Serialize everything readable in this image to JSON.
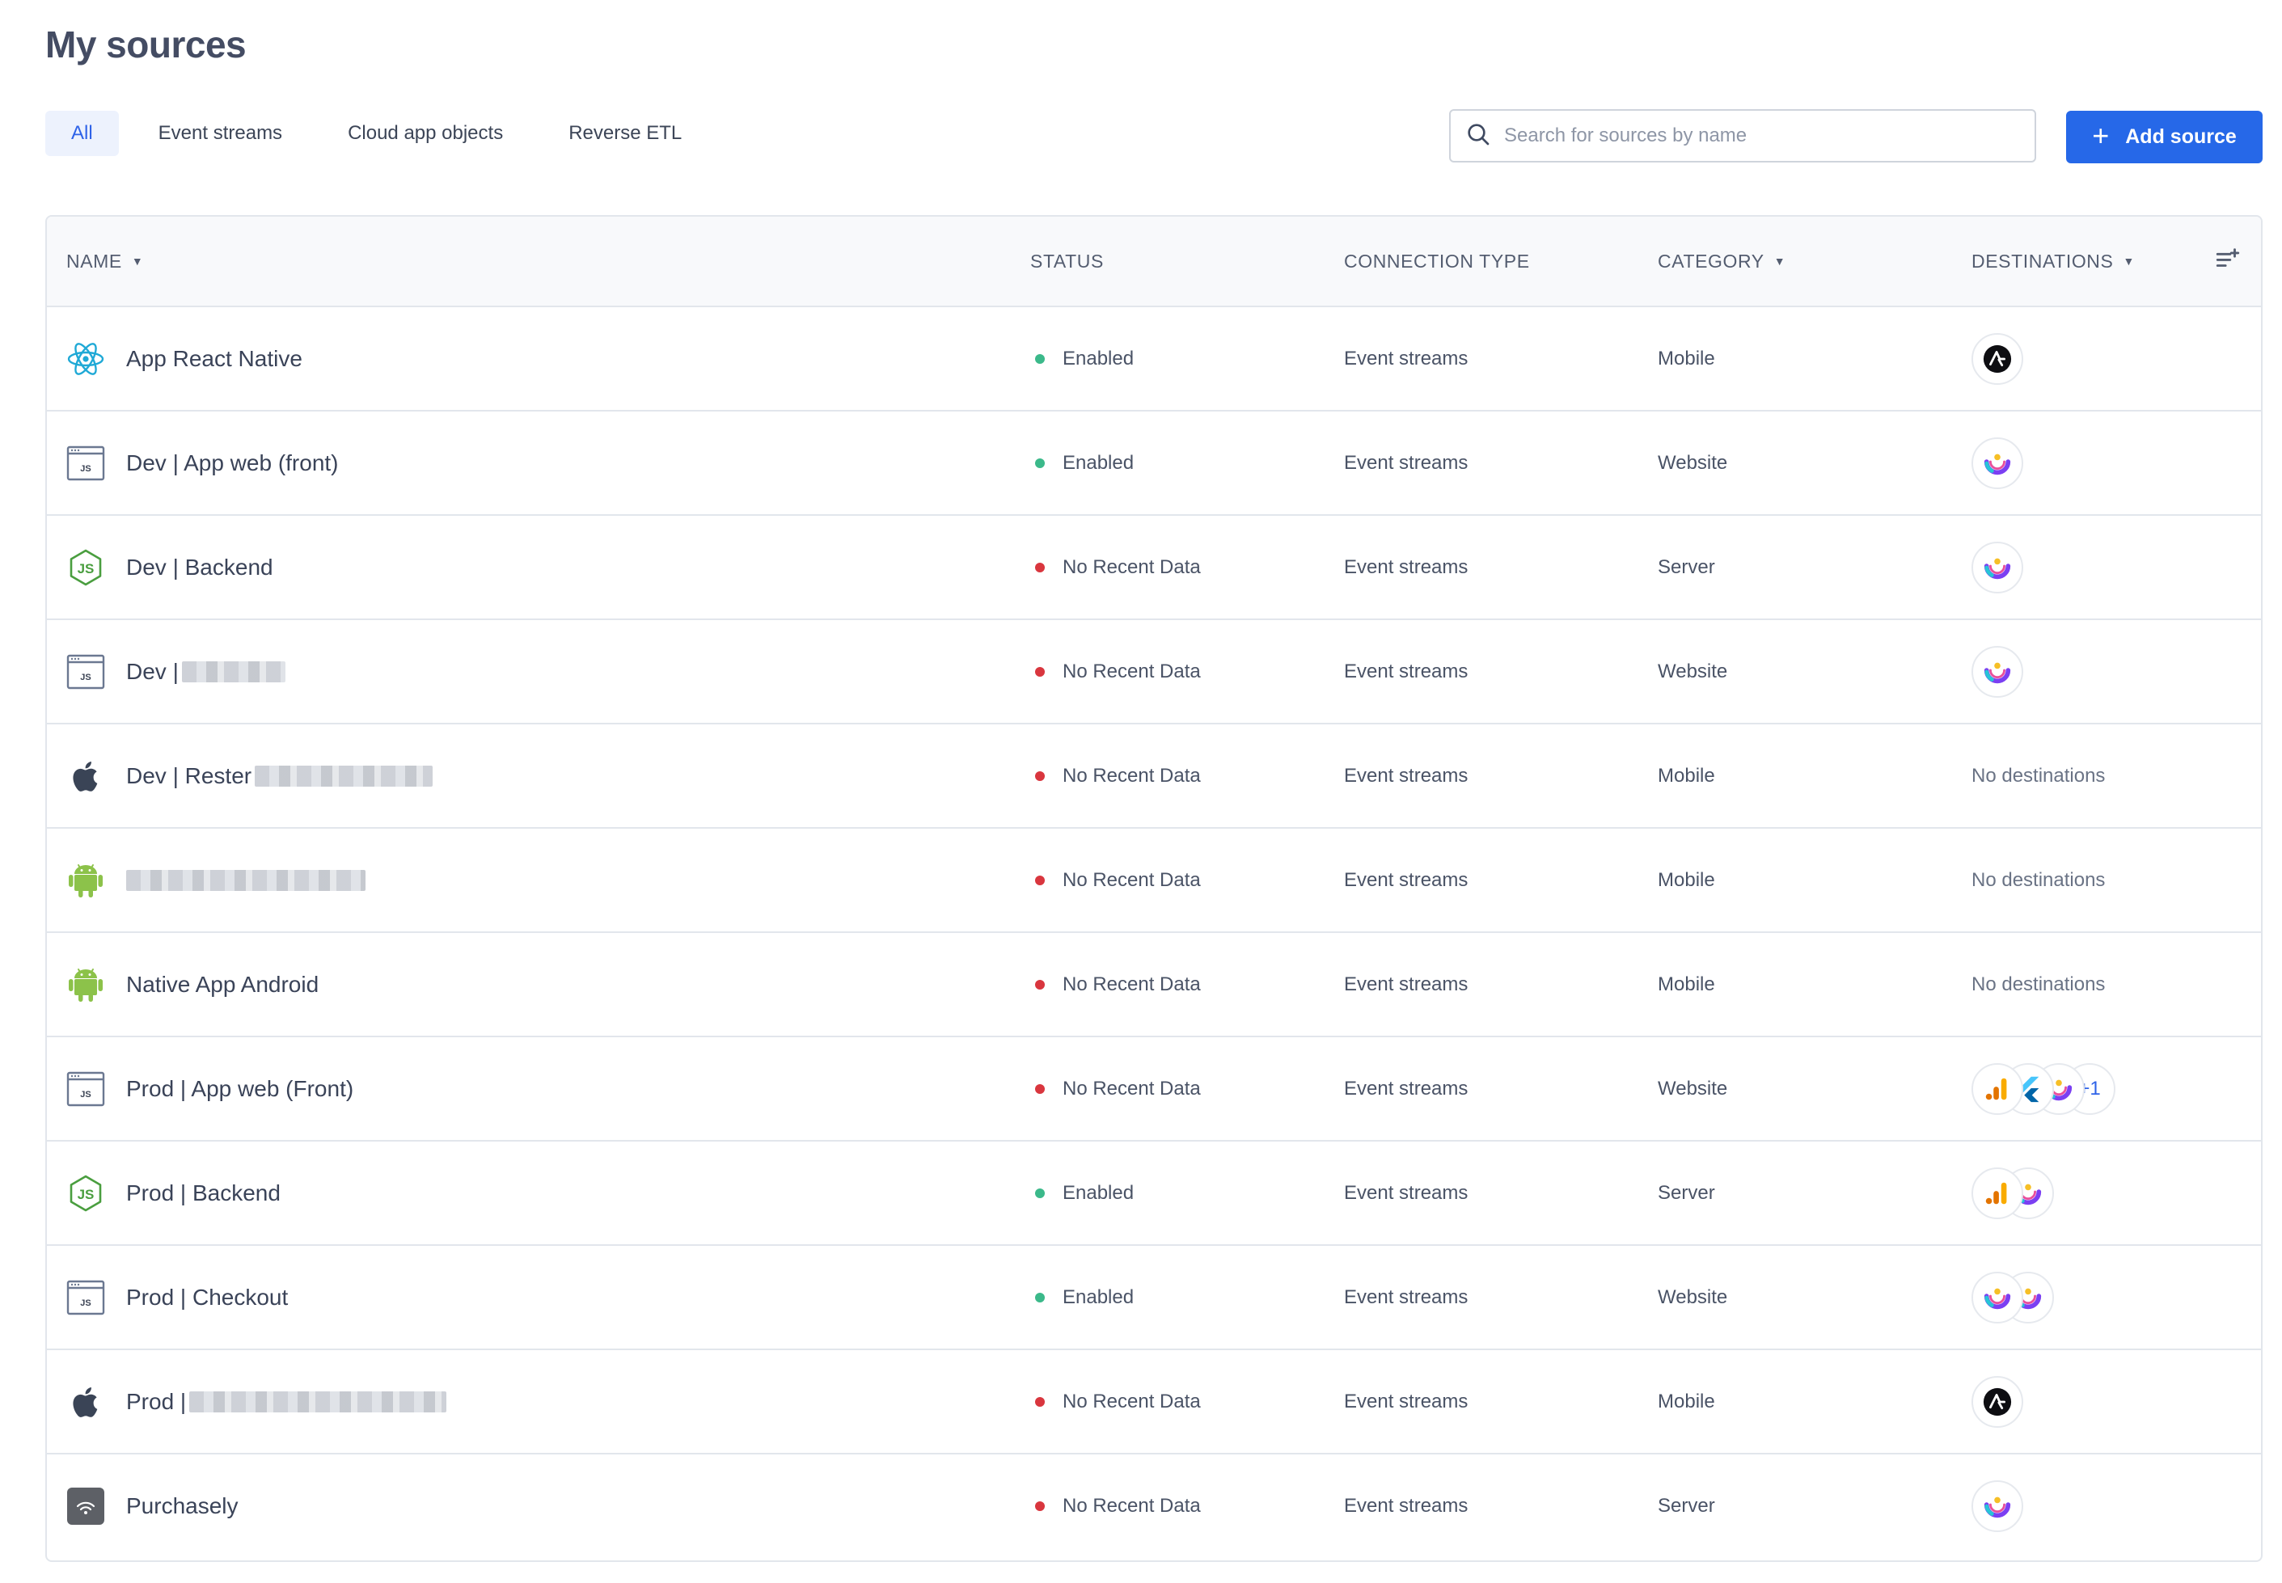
{
  "page": {
    "title": "My sources"
  },
  "tabs": [
    {
      "label": "All",
      "active": true
    },
    {
      "label": "Event streams",
      "active": false
    },
    {
      "label": "Cloud app objects",
      "active": false
    },
    {
      "label": "Reverse ETL",
      "active": false
    }
  ],
  "search": {
    "placeholder": "Search for sources by name",
    "value": ""
  },
  "actions": {
    "add_source_label": "Add source"
  },
  "table": {
    "headers": {
      "name": "NAME",
      "status": "STATUS",
      "connection_type": "CONNECTION TYPE",
      "category": "CATEGORY",
      "destinations": "DESTINATIONS"
    },
    "rows": [
      {
        "icon": "react-icon",
        "name": "App React Native",
        "redacted": false,
        "status": "Enabled",
        "connection_type": "Event streams",
        "category": "Mobile",
        "destinations": [
          "amplitude-icon"
        ],
        "destinations_more": "",
        "destinations_text": ""
      },
      {
        "icon": "javascript-icon",
        "name": "Dev | App web (front)",
        "redacted": false,
        "status": "Enabled",
        "connection_type": "Event streams",
        "category": "Website",
        "destinations": [
          "mixpanel-icon"
        ],
        "destinations_more": "",
        "destinations_text": ""
      },
      {
        "icon": "nodejs-icon",
        "name": "Dev | Backend",
        "redacted": false,
        "status": "No Recent Data",
        "connection_type": "Event streams",
        "category": "Server",
        "destinations": [
          "mixpanel-icon"
        ],
        "destinations_more": "",
        "destinations_text": ""
      },
      {
        "icon": "javascript-icon",
        "name": "Dev |",
        "redacted": true,
        "status": "No Recent Data",
        "connection_type": "Event streams",
        "category": "Website",
        "destinations": [
          "mixpanel-icon"
        ],
        "destinations_more": "",
        "destinations_text": ""
      },
      {
        "icon": "apple-icon",
        "name": "Dev | Rester",
        "redacted": true,
        "status": "No Recent Data",
        "connection_type": "Event streams",
        "category": "Mobile",
        "destinations": [],
        "destinations_more": "",
        "destinations_text": "No destinations"
      },
      {
        "icon": "android-icon",
        "name": "",
        "redacted": true,
        "status": "No Recent Data",
        "connection_type": "Event streams",
        "category": "Mobile",
        "destinations": [],
        "destinations_more": "",
        "destinations_text": "No destinations"
      },
      {
        "icon": "android-icon",
        "name": "Native App Android",
        "redacted": false,
        "status": "No Recent Data",
        "connection_type": "Event streams",
        "category": "Mobile",
        "destinations": [],
        "destinations_more": "",
        "destinations_text": "No destinations"
      },
      {
        "icon": "javascript-icon",
        "name": "Prod | App web (Front)",
        "redacted": false,
        "status": "No Recent Data",
        "connection_type": "Event streams",
        "category": "Website",
        "destinations": [
          "google-analytics-icon",
          "flutter-icon",
          "mixpanel-icon"
        ],
        "destinations_more": "+1",
        "destinations_text": ""
      },
      {
        "icon": "nodejs-icon",
        "name": "Prod | Backend",
        "redacted": false,
        "status": "Enabled",
        "connection_type": "Event streams",
        "category": "Server",
        "destinations": [
          "google-analytics-icon",
          "mixpanel-icon"
        ],
        "destinations_more": "",
        "destinations_text": ""
      },
      {
        "icon": "javascript-icon",
        "name": "Prod | Checkout",
        "redacted": false,
        "status": "Enabled",
        "connection_type": "Event streams",
        "category": "Website",
        "destinations": [
          "mixpanel-icon",
          "mixpanel-icon"
        ],
        "destinations_more": "",
        "destinations_text": ""
      },
      {
        "icon": "apple-icon",
        "name": "Prod |",
        "redacted": true,
        "status": "No Recent Data",
        "connection_type": "Event streams",
        "category": "Mobile",
        "destinations": [
          "amplitude-icon"
        ],
        "destinations_more": "",
        "destinations_text": ""
      },
      {
        "icon": "purchasely-icon",
        "name": "Purchasely",
        "redacted": false,
        "status": "No Recent Data",
        "connection_type": "Event streams",
        "category": "Server",
        "destinations": [
          "mixpanel-icon"
        ],
        "destinations_more": "",
        "destinations_text": ""
      }
    ]
  },
  "colors": {
    "accent": "#2668e8",
    "status_enabled": "#3bb98a",
    "status_no_recent_data": "#d9363e"
  }
}
